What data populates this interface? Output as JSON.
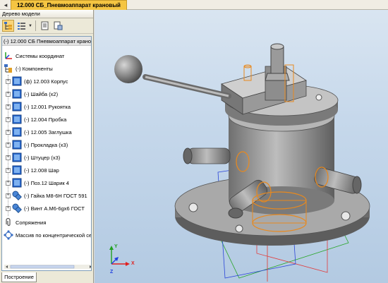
{
  "window": {
    "back_label": "◂",
    "doc_tab": "12.000 СБ_Пневмоаппарат крановый"
  },
  "panel": {
    "title": "Дерево модели",
    "bottom_tab": "Построение"
  },
  "tree": {
    "root": "(-) 12.000 СБ Пневмоаппарат крановы",
    "coords": "Системы координат",
    "components": "(-) Компоненты",
    "items": [
      {
        "label": "(ф) 12.003 Корпус",
        "icon": "part-icon"
      },
      {
        "label": "(-) Шайба (x2)",
        "icon": "part-icon"
      },
      {
        "label": "(-) 12.001 Рукоятка",
        "icon": "part-icon"
      },
      {
        "label": "(-) 12.004 Пробка",
        "icon": "part-icon"
      },
      {
        "label": "(-) 12.005 Заглушка",
        "icon": "part-icon"
      },
      {
        "label": "(-) Прокладка (x3)",
        "icon": "part-icon"
      },
      {
        "label": "(-) Штуцер (x3)",
        "icon": "part-icon"
      },
      {
        "label": "(-) 12.008 Шар",
        "icon": "part-icon"
      },
      {
        "label": "(-) Поз.12 Шарик 4",
        "icon": "part-icon"
      },
      {
        "label": "(-) Гайка М8-6H ГОСТ 591",
        "icon": "standard-part-icon"
      },
      {
        "label": "(-) Винт А.М6-6gx6 ГОСТ",
        "icon": "standard-part-icon"
      }
    ],
    "mates": "Сопряжения",
    "array": "Массив по концентрической се"
  },
  "axes": {
    "x": "X",
    "y": "Y",
    "z": "Z"
  },
  "colors": {
    "tab_active": "#f5c542",
    "viewport_top": "#d9e5f1",
    "part_gray": "#8f8f8f",
    "highlight_orange": "#e8891e",
    "axis_x": "#e02020",
    "axis_y": "#20a020",
    "axis_z": "#2040e0"
  }
}
